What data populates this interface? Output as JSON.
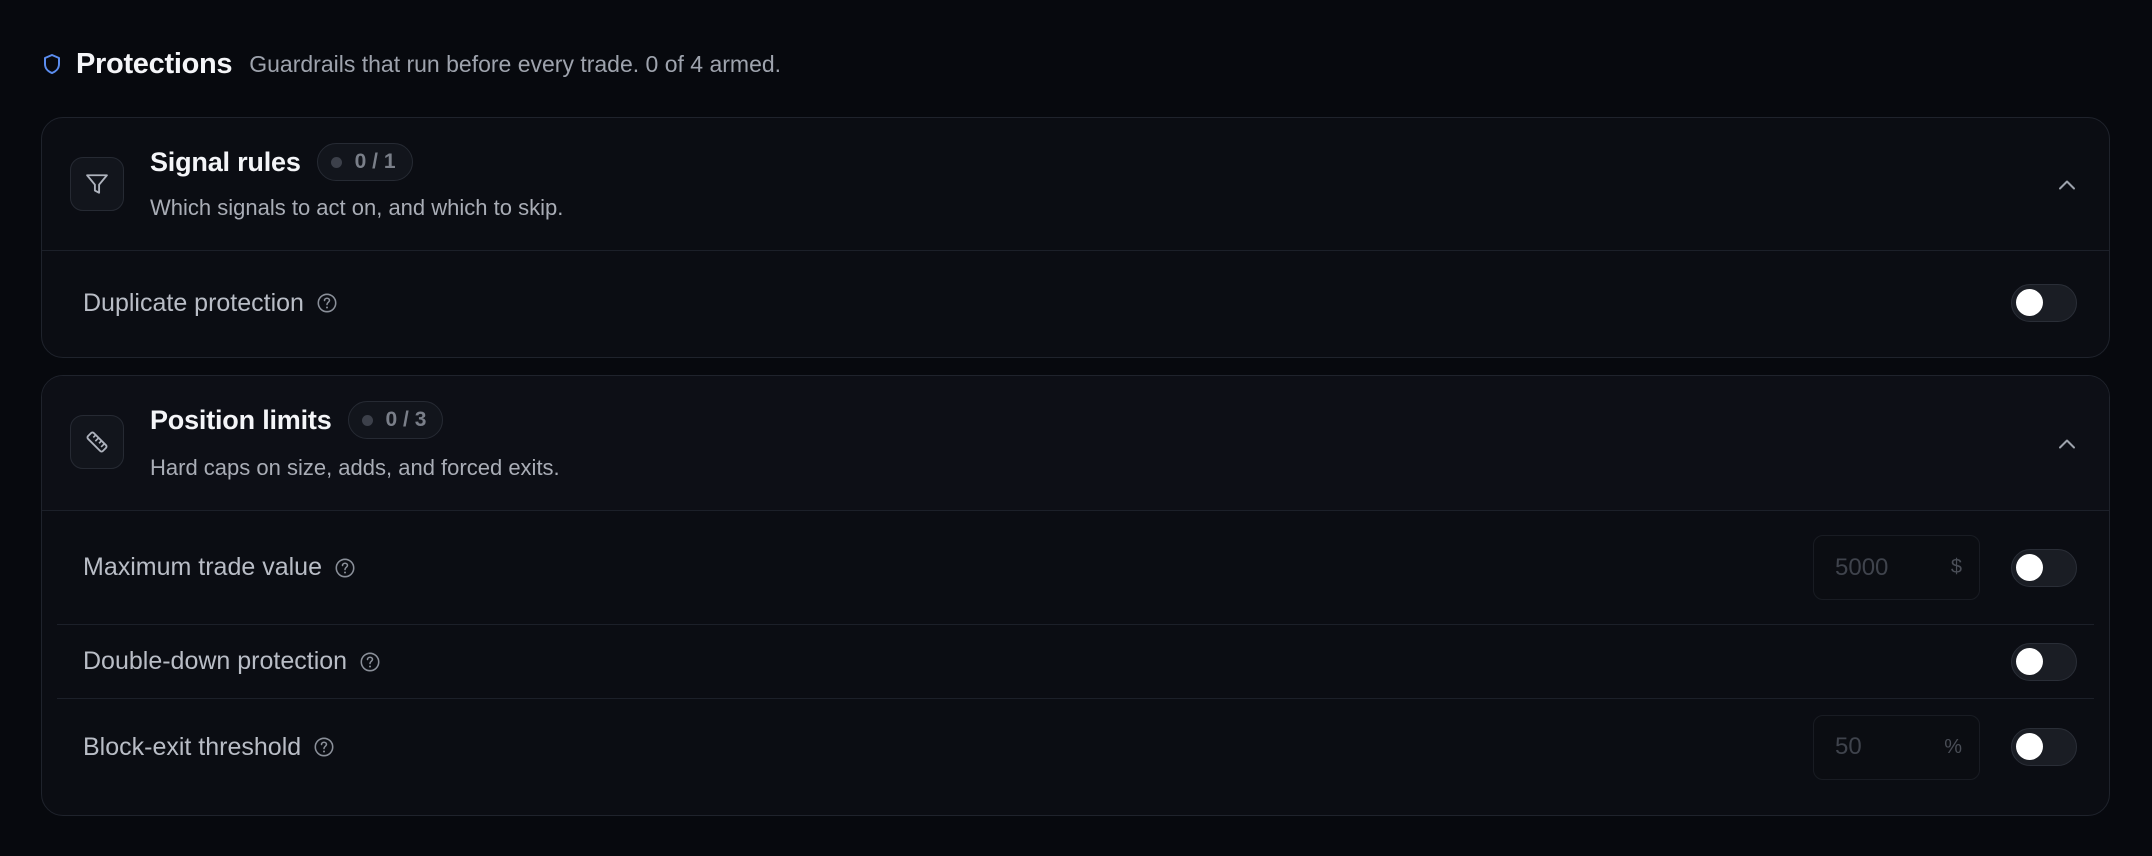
{
  "header": {
    "title": "Protections",
    "subtitle": "Guardrails that run before every trade. 0 of 4 armed.",
    "icon": "shield-icon",
    "accent": "#5b8def"
  },
  "sections": [
    {
      "title": "Signal rules",
      "count": "0 / 1",
      "description": "Which signals to act on, and which to skip.",
      "icon": "filter-icon",
      "expanded": true,
      "rules": [
        {
          "label": "Duplicate protection",
          "enabled": false
        }
      ]
    },
    {
      "title": "Position limits",
      "count": "0 / 3",
      "description": "Hard caps on size, adds, and forced exits.",
      "icon": "ruler-icon",
      "expanded": true,
      "rules": [
        {
          "label": "Maximum trade value",
          "value": "5000",
          "unit": "$",
          "enabled": false
        },
        {
          "label": "Double-down protection",
          "enabled": false
        },
        {
          "label": "Block-exit threshold",
          "value": "50",
          "unit": "%",
          "enabled": false
        }
      ]
    }
  ]
}
